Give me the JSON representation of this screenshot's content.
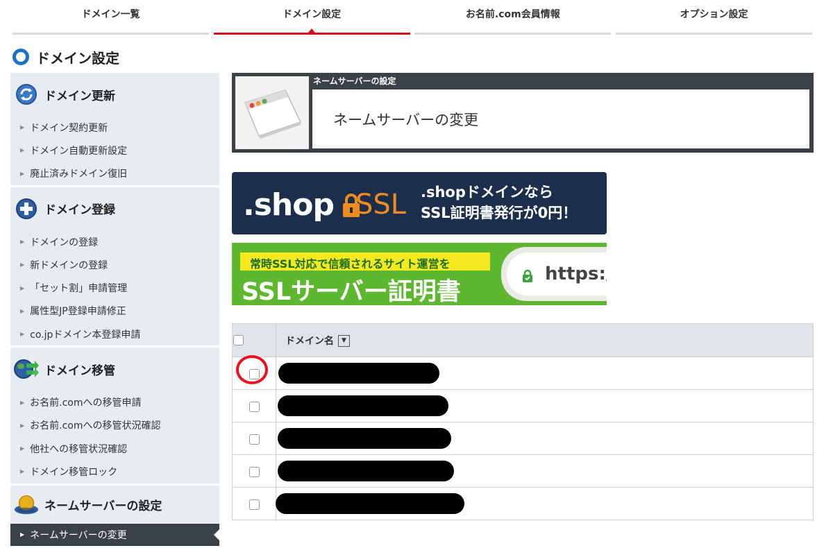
{
  "tabs": [
    "ドメイン一覧",
    "ドメイン設定",
    "お名前.com会員情報",
    "オプション設定"
  ],
  "active_tab": 1,
  "page_title": "ドメイン設定",
  "sidebar": [
    {
      "title": "ドメイン更新",
      "icon": "refresh-globe-icon",
      "items": [
        "ドメイン契約更新",
        "ドメイン自動更新設定",
        "廃止済みドメイン復旧"
      ]
    },
    {
      "title": "ドメイン登録",
      "icon": "add-globe-icon",
      "items": [
        "ドメインの登録",
        "新ドメインの登録",
        "「セット割」申請管理",
        "属性型JP登録申請修正",
        "co.jpドメイン本登録申請"
      ]
    },
    {
      "title": "ドメイン移管",
      "icon": "transfer-globe-icon",
      "items": [
        "お名前.comへの移管申請",
        "お名前.comへの移管状況確認",
        "他社への移管状況確認",
        "ドメイン移管ロック"
      ]
    },
    {
      "title": "ネームサーバーの設定",
      "icon": "nameserver-icon",
      "items": [
        "ネームサーバーの変更"
      ]
    }
  ],
  "main": {
    "caption": "ネームサーバーの設定",
    "heading": "ネームサーバーの変更"
  },
  "banner_shop": {
    "word": ".shop",
    "ssl": "SSL",
    "line1": ".shopドメインなら",
    "line2": "SSL証明書発行が0円！"
  },
  "banner_ssl": {
    "tag": "常時SSL対応で信頼されるサイト運営を",
    "title": "SSLサーバー証明書",
    "url": "https:/"
  },
  "table": {
    "header": "ドメイン名",
    "sort_icon": "▼",
    "row_count": 5
  }
}
